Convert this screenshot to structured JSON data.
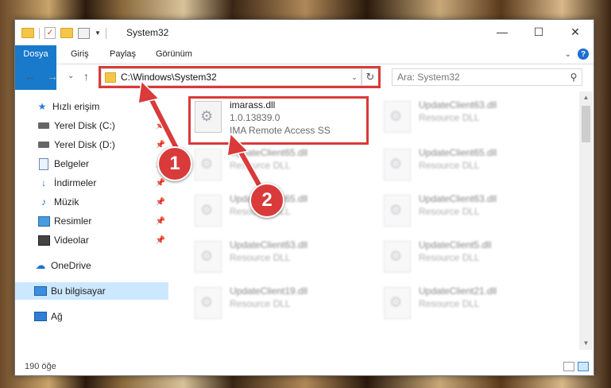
{
  "window": {
    "title": "System32",
    "controls": {
      "minimize": "—",
      "maximize": "☐",
      "close": "✕"
    }
  },
  "ribbon": {
    "tabs": [
      "Dosya",
      "Giriş",
      "Paylaş",
      "Görünüm"
    ],
    "help": "?"
  },
  "nav": {
    "back": "←",
    "forward": "→",
    "recent": "⌄",
    "up": "↑",
    "address": "C:\\Windows\\System32",
    "search_placeholder": "Ara: System32"
  },
  "sidebar": {
    "items": [
      {
        "label": "Hızlı erişim",
        "icon": "star-icon",
        "pinned": false
      },
      {
        "label": "Yerel Disk (C:)",
        "icon": "drive-icon",
        "pinned": true
      },
      {
        "label": "Yerel Disk (D:)",
        "icon": "drive-icon",
        "pinned": true
      },
      {
        "label": "Belgeler",
        "icon": "documents-icon",
        "pinned": true
      },
      {
        "label": "İndirmeler",
        "icon": "download-icon",
        "pinned": true
      },
      {
        "label": "Müzik",
        "icon": "music-icon",
        "pinned": true
      },
      {
        "label": "Resimler",
        "icon": "pictures-icon",
        "pinned": true
      },
      {
        "label": "Videolar",
        "icon": "videos-icon",
        "pinned": true
      },
      {
        "label": "OneDrive",
        "icon": "cloud-icon",
        "pinned": false
      },
      {
        "label": "Bu bilgisayar",
        "icon": "pc-icon",
        "pinned": false,
        "selected": true
      },
      {
        "label": "Ağ",
        "icon": "network-icon",
        "pinned": false
      }
    ]
  },
  "files": [
    {
      "name": "imarass.dll",
      "line2": "1.0.13839.0",
      "line3": "IMA Remote Access SS",
      "highlighted": true
    },
    {
      "name": "UpdateClient63.dll",
      "line2": "Resource DLL"
    },
    {
      "name": "UpdateClient65.dll",
      "line2": "Resource DLL"
    },
    {
      "name": "UpdateClient65.dll",
      "line2": "Resource DLL"
    },
    {
      "name": "UpdateClient65.dll",
      "line2": "Resource DLL"
    },
    {
      "name": "UpdateClient63.dll",
      "line2": "Resource DLL"
    },
    {
      "name": "UpdateClient63.dll",
      "line2": "Resource DLL"
    },
    {
      "name": "UpdateClient5.dll",
      "line2": "Resource DLL"
    },
    {
      "name": "UpdateClient19.dll",
      "line2": "Resource DLL"
    },
    {
      "name": "UpdateClient21.dll",
      "line2": "Resource DLL"
    }
  ],
  "status": {
    "count": "190 öğe"
  },
  "annotations": {
    "step1": "1",
    "step2": "2",
    "color": "#d93a3a"
  }
}
